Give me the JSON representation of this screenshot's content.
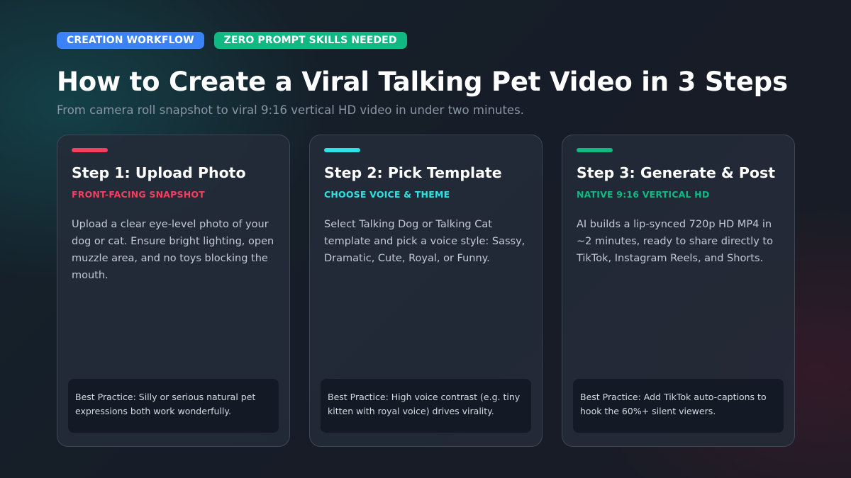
{
  "badges": {
    "workflow": "CREATION WORKFLOW",
    "no_prompt": "ZERO PROMPT SKILLS NEEDED"
  },
  "header": {
    "title": "How to Create a Viral Talking Pet Video in 3 Steps",
    "subtitle": "From camera roll snapshot to viral 9:16 vertical HD video in under two minutes."
  },
  "colors": {
    "badge_blue": "#3b82f6",
    "badge_green": "#10b981",
    "step1_accent": "#f43f5e",
    "step2_accent": "#2de2e6",
    "step3_accent": "#10b981"
  },
  "steps": [
    {
      "title": "Step 1: Upload Photo",
      "tag": "FRONT-FACING SNAPSHOT",
      "description": "Upload a clear eye-level photo of your dog or cat. Ensure bright lighting, open muzzle area, and no toys blocking the mouth.",
      "tip": "Best Practice: Silly or serious natural pet expressions both work wonderfully."
    },
    {
      "title": "Step 2: Pick Template",
      "tag": "CHOOSE VOICE & THEME",
      "description": "Select Talking Dog or Talking Cat template and pick a voice style: Sassy, Dramatic, Cute, Royal, or Funny.",
      "tip": "Best Practice: High voice contrast (e.g. tiny kitten with royal voice) drives virality."
    },
    {
      "title": "Step 3: Generate & Post",
      "tag": "NATIVE 9:16 VERTICAL HD",
      "description": "AI builds a lip-synced 720p HD MP4 in ~2 minutes, ready to share directly to TikTok, Instagram Reels, and Shorts.",
      "tip": "Best Practice: Add TikTok auto-captions to hook the 60%+ silent viewers."
    }
  ]
}
